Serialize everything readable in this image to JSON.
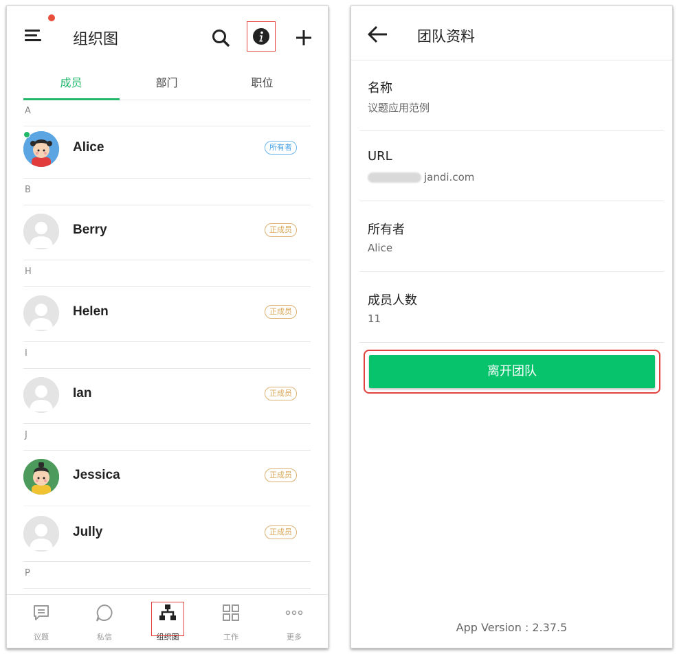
{
  "left": {
    "header": {
      "title": "组织图"
    },
    "tabs": [
      "成员",
      "部门",
      "职位"
    ],
    "sections": {
      "a": "A",
      "b": "B",
      "h": "H",
      "i": "I",
      "j": "J",
      "p": "P"
    },
    "members": [
      {
        "name": "Alice",
        "role": "所有者"
      },
      {
        "name": "Berry",
        "role": "正成员"
      },
      {
        "name": "Helen",
        "role": "正成员"
      },
      {
        "name": "Ian",
        "role": "正成员"
      },
      {
        "name": "Jessica",
        "role": "正成员"
      },
      {
        "name": "Jully",
        "role": "正成员"
      }
    ],
    "bottom_nav": [
      "议题",
      "私信",
      "组织图",
      "工作",
      "更多"
    ]
  },
  "right": {
    "header": {
      "title": "团队资料"
    },
    "fields": [
      {
        "label": "名称",
        "value": "议题应用范例"
      },
      {
        "label": "URL",
        "value": "jandi.com"
      },
      {
        "label": "所有者",
        "value": "Alice"
      },
      {
        "label": "成员人数",
        "value": "11"
      }
    ],
    "leave_button": "离开团队",
    "app_version": "App Version : 2.37.5"
  },
  "colors": {
    "accent": "#21b86a",
    "button": "#07c36c",
    "highlight": "#e2413d",
    "owner_badge": "#4aa3e6",
    "member_badge": "#d9a654"
  }
}
